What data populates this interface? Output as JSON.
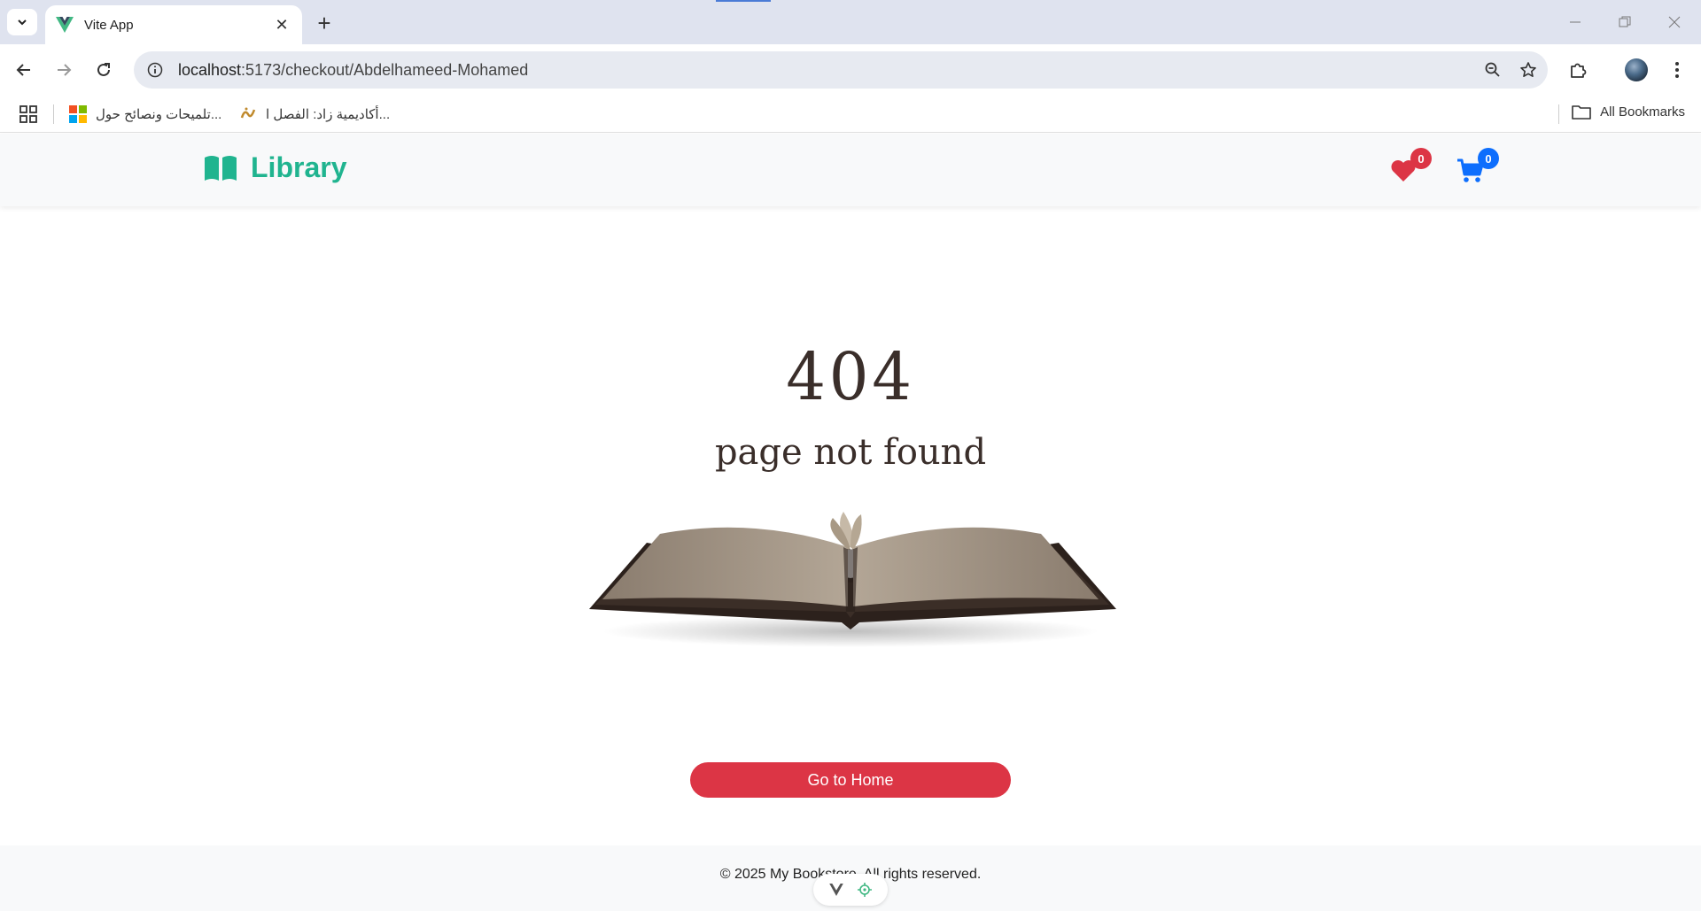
{
  "browser": {
    "tab_title": "Vite App",
    "url_host": "localhost",
    "url_path": ":5173/checkout/Abdelhameed-Mohamed",
    "bookmarks": [
      {
        "label": "تلميحات ونصائح حول...",
        "icon": "microsoft-icon"
      },
      {
        "label": "أكاديمية زاد: الفصل ا...",
        "icon": "zad-icon"
      }
    ],
    "all_bookmarks_label": "All Bookmarks"
  },
  "header": {
    "brand": "Library",
    "wishlist_count": "0",
    "cart_count": "0",
    "colors": {
      "brand": "#20b48f",
      "wishlist": "#dc3545",
      "cart": "#0d6efd"
    }
  },
  "not_found": {
    "code": "404",
    "message": "page not found",
    "button_label": "Go to Home"
  },
  "footer": {
    "text": "© 2025 My Bookstore. All rights reserved."
  }
}
